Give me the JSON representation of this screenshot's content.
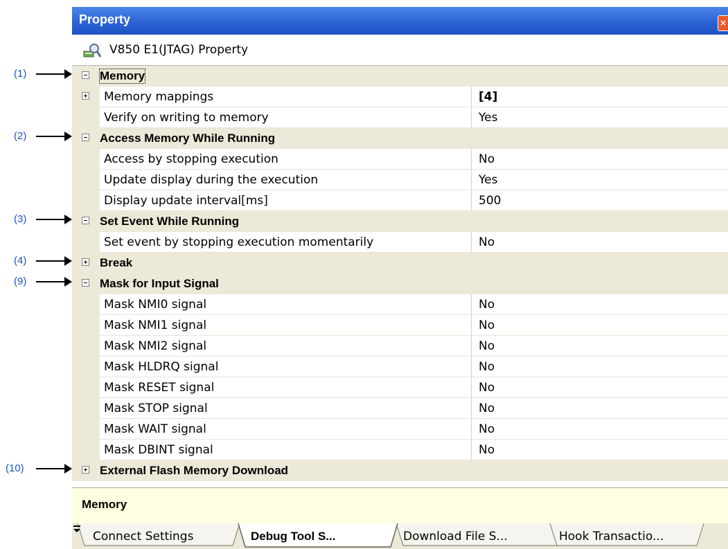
{
  "callouts": [
    "(1)",
    "(2)",
    "(3)",
    "(4)",
    "(9)",
    "(10)"
  ],
  "window": {
    "title": "Property",
    "close_icon": "close-icon"
  },
  "header": {
    "icon": "property-icon",
    "title": "V850 E1(JTAG) Property"
  },
  "rows": [
    {
      "kind": "category",
      "expanded": true,
      "label": "Memory",
      "callout": "(1)"
    },
    {
      "kind": "property",
      "expandable": true,
      "expanded": false,
      "label": "Memory mappings",
      "value": "[4]",
      "value_bold": true
    },
    {
      "kind": "property",
      "label": "Verify on writing to memory",
      "value": "Yes"
    },
    {
      "kind": "category",
      "expanded": true,
      "label": "Access Memory While Running",
      "callout": "(2)"
    },
    {
      "kind": "property",
      "label": "Access by stopping execution",
      "value": "No"
    },
    {
      "kind": "property",
      "label": "Update display during the execution",
      "value": "Yes"
    },
    {
      "kind": "property",
      "label": "Display update interval[ms]",
      "value": "500"
    },
    {
      "kind": "category",
      "expanded": true,
      "label": "Set Event While Running",
      "callout": "(3)"
    },
    {
      "kind": "property",
      "label": "Set event by stopping execution momentarily",
      "value": "No"
    },
    {
      "kind": "category",
      "expanded": false,
      "label": "Break",
      "callout": "(4)"
    },
    {
      "kind": "category",
      "expanded": true,
      "label": "Mask for Input Signal",
      "callout": "(9)"
    },
    {
      "kind": "property",
      "label": "Mask NMI0 signal",
      "value": "No"
    },
    {
      "kind": "property",
      "label": "Mask NMI1 signal",
      "value": "No"
    },
    {
      "kind": "property",
      "label": "Mask NMI2 signal",
      "value": "No"
    },
    {
      "kind": "property",
      "label": "Mask HLDRQ signal",
      "value": "No"
    },
    {
      "kind": "property",
      "label": "Mask RESET signal",
      "value": "No"
    },
    {
      "kind": "property",
      "label": "Mask STOP signal",
      "value": "No"
    },
    {
      "kind": "property",
      "label": "Mask WAIT signal",
      "value": "No"
    },
    {
      "kind": "property",
      "label": "Mask DBINT signal",
      "value": "No"
    },
    {
      "kind": "category",
      "expanded": false,
      "label": "External Flash Memory Download",
      "callout": "(10)"
    }
  ],
  "description": {
    "text": "Memory"
  },
  "tabs": [
    {
      "label": "Connect Settings",
      "active": false
    },
    {
      "label": "Debug Tool S...",
      "active": true
    },
    {
      "label": "Download File S...",
      "active": false
    },
    {
      "label": "Hook Transactio...",
      "active": false
    }
  ],
  "tab_overflow_icon": "overflow-menu-icon",
  "colors": {
    "title_bar": "#2c64d6",
    "category_bg": "#ece9d8",
    "description_bg": "#ffffe1",
    "callout_text": "#1a53c9"
  }
}
